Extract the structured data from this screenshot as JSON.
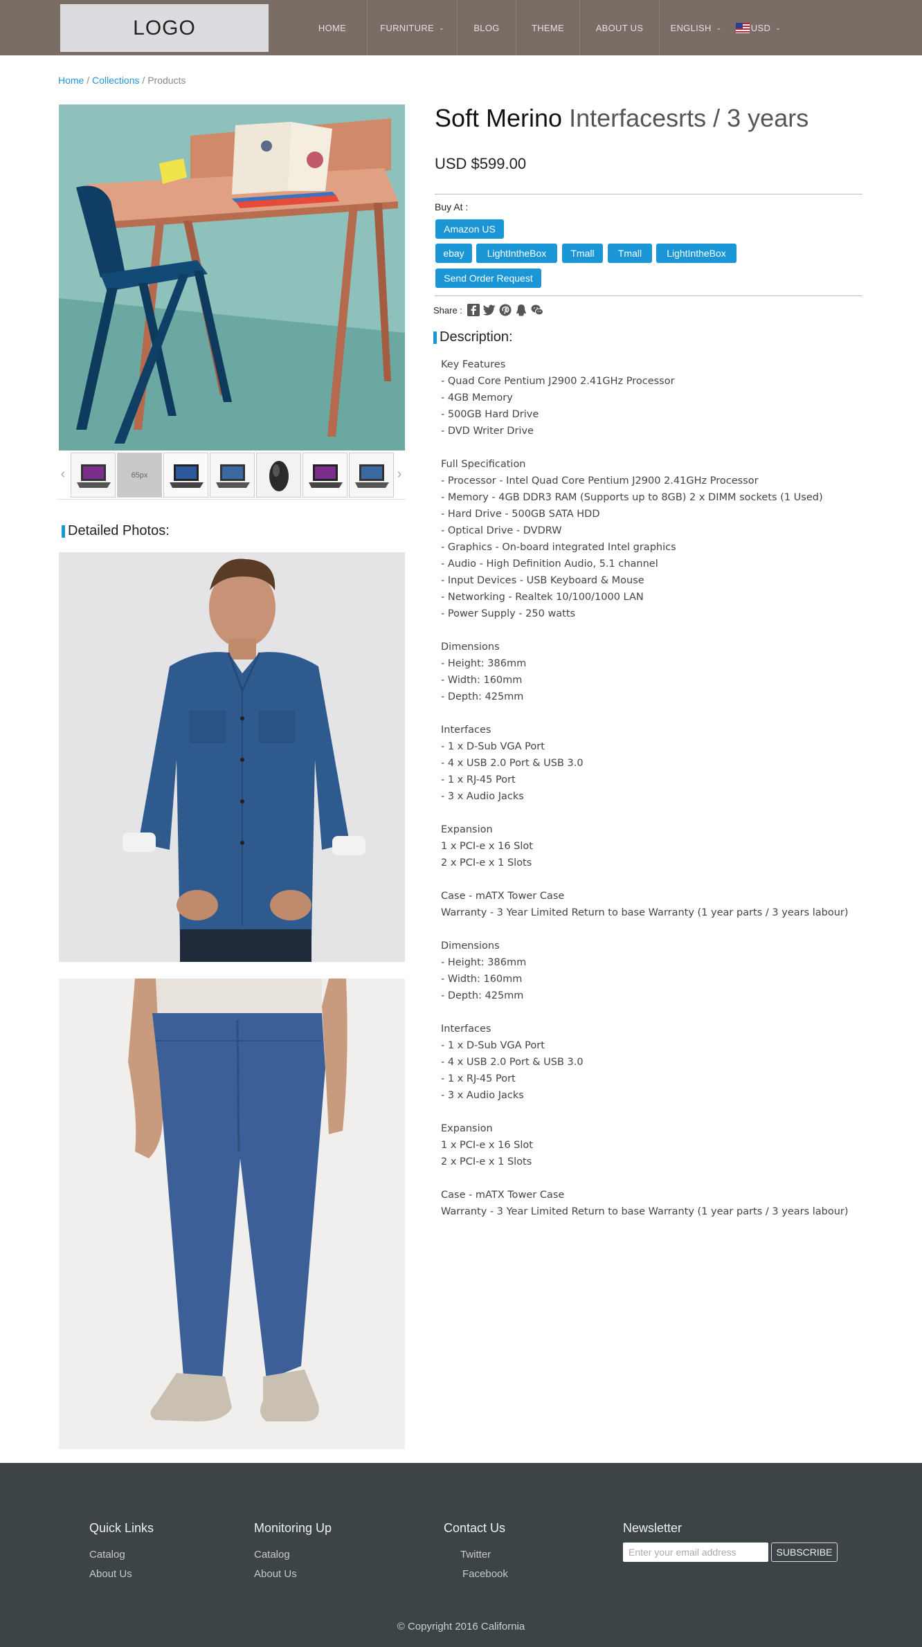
{
  "header": {
    "logo": "LOGO",
    "nav": [
      "HOME",
      "FURNITURE",
      "BLOG",
      "THEME",
      "ABOUT US"
    ],
    "language": "ENGLISH",
    "currency": "USD"
  },
  "breadcrumb": {
    "home": "Home",
    "sep1": " / ",
    "collections": "Collections",
    "sep2": " / ",
    "current": "Products"
  },
  "gallery": {
    "placeholder_label": "65px"
  },
  "detailed_photos_title": "Detailed Photos:",
  "product": {
    "title": "Soft Merino",
    "subtitle": " Interfacesrts / 3 years",
    "price": "USD $599.00"
  },
  "buy": {
    "label": "Buy At :",
    "buttons": [
      "Amazon US",
      "ebay",
      "LightIntheBox",
      "Tmall",
      "Tmall",
      "LightIntheBox",
      "Send Order Request"
    ]
  },
  "share": {
    "label": "Share :"
  },
  "description": {
    "title": "Description:",
    "lines": [
      "Key Features",
      " - Quad Core Pentium J2900 2.41GHz Processor",
      " - 4GB Memory",
      " - 500GB Hard Drive",
      " - DVD Writer Drive",
      "",
      "Full Specification",
      " - Processor - Intel Quad Core Pentium J2900 2.41GHz Processor",
      " - Memory - 4GB DDR3 RAM (Supports up to 8GB) 2 x DIMM sockets (1 Used)",
      " - Hard Drive - 500GB SATA HDD",
      " - Optical Drive - DVDRW",
      " - Graphics - On-board integrated Intel graphics",
      " - Audio - High Definition Audio, 5.1 channel",
      " - Input Devices - USB Keyboard & Mouse",
      " - Networking - Realtek 10/100/1000 LAN",
      " - Power Supply - 250 watts",
      "",
      "Dimensions",
      " - Height: 386mm",
      " - Width: 160mm",
      " - Depth: 425mm",
      "",
      "Interfaces",
      " - 1 x D-Sub VGA Port",
      " - 4 x USB 2.0 Port & USB 3.0",
      " - 1 x RJ-45 Port",
      " - 3 x Audio Jacks",
      "",
      "Expansion",
      "1 x PCI-e x 16 Slot",
      "2 x PCI-e x 1 Slots",
      "",
      "Case - mATX Tower Case",
      "Warranty - 3 Year Limited Return to base Warranty (1 year parts / 3 years labour)",
      "",
      "Dimensions",
      " - Height: 386mm",
      " - Width: 160mm",
      " - Depth: 425mm",
      "",
      "Interfaces",
      " - 1 x D-Sub VGA Port",
      " - 4 x USB 2.0 Port & USB 3.0",
      " - 1 x RJ-45 Port",
      " - 3 x Audio Jacks",
      "",
      "Expansion",
      "1 x PCI-e x 16 Slot",
      "2 x PCI-e x 1 Slots",
      "",
      "Case - mATX Tower Case",
      "Warranty - 3 Year Limited Return to base Warranty (1 year parts / 3 years labour)"
    ]
  },
  "footer": {
    "quick_links": {
      "title": "Quick Links",
      "links": [
        "Catalog",
        "About Us"
      ]
    },
    "monitoring": {
      "title": "Monitoring Up",
      "links": [
        "Catalog",
        "About Us"
      ]
    },
    "contact": {
      "title": "Contact Us",
      "links": [
        "Twitter",
        "Facebook"
      ]
    },
    "newsletter": {
      "title": "Newsletter",
      "placeholder": "Enter your email address",
      "button": "SUBSCRIBE"
    },
    "copyright": "© Copyright 2016 California"
  },
  "colors": {
    "accent": "#1a96d6",
    "header_bg": "#7a6d66",
    "footer_bg": "#3d4447"
  }
}
